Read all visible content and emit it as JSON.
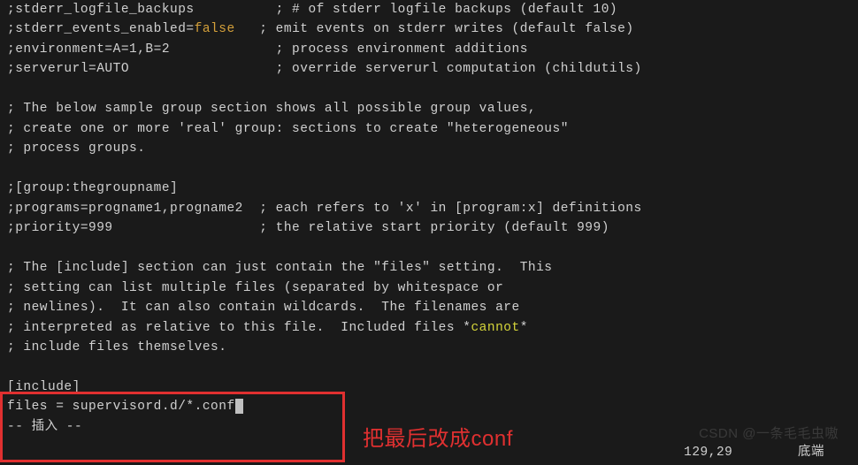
{
  "lines": [
    {
      "segments": [
        {
          "t": ";stderr_logfile_backups          ; # of stderr logfile backups (default 10)"
        }
      ]
    },
    {
      "segments": [
        {
          "t": ";stderr_events_enabled="
        },
        {
          "t": "false",
          "cls": "kw-false"
        },
        {
          "t": "   ; emit events on stderr writes (default false)"
        }
      ]
    },
    {
      "segments": [
        {
          "t": ";environment=A=1,B=2             ; process environment additions"
        }
      ]
    },
    {
      "segments": [
        {
          "t": ";serverurl=AUTO                  ; override serverurl computation (childutils)"
        }
      ]
    },
    {
      "segments": [
        {
          "t": " "
        }
      ]
    },
    {
      "segments": [
        {
          "t": "; The below sample group section shows all possible group values,"
        }
      ]
    },
    {
      "segments": [
        {
          "t": "; create one or more 'real' group: sections to create \"heterogeneous\""
        }
      ]
    },
    {
      "segments": [
        {
          "t": "; process groups."
        }
      ]
    },
    {
      "segments": [
        {
          "t": " "
        }
      ]
    },
    {
      "segments": [
        {
          "t": ";[group:thegroupname]"
        }
      ]
    },
    {
      "segments": [
        {
          "t": ";programs=progname1,progname2  ; each refers to 'x' in [program:x] definitions"
        }
      ]
    },
    {
      "segments": [
        {
          "t": ";priority=999                  ; the relative start priority (default 999)"
        }
      ]
    },
    {
      "segments": [
        {
          "t": " "
        }
      ]
    },
    {
      "segments": [
        {
          "t": "; The [include] section can just contain the \"files\" setting.  This"
        }
      ]
    },
    {
      "segments": [
        {
          "t": "; setting can list multiple files (separated by whitespace or"
        }
      ]
    },
    {
      "segments": [
        {
          "t": "; newlines).  It can also contain wildcards.  The filenames are"
        }
      ]
    },
    {
      "segments": [
        {
          "t": "; interpreted as relative to this file.  Included files *"
        },
        {
          "t": "cannot",
          "cls": "kw-cannot"
        },
        {
          "t": "*"
        }
      ]
    },
    {
      "segments": [
        {
          "t": "; include files themselves."
        }
      ]
    },
    {
      "segments": [
        {
          "t": " "
        }
      ]
    },
    {
      "segments": [
        {
          "t": "[include]"
        }
      ]
    },
    {
      "segments": [
        {
          "t": "files = supervisord.d/*.conf"
        },
        {
          "cursor": true
        }
      ]
    },
    {
      "segments": [
        {
          "t": "-- 插入 --"
        }
      ]
    }
  ],
  "annotation": "把最后改成conf",
  "watermark": "CSDN @一条毛毛虫嗷",
  "status": {
    "position": "129,29",
    "location": "底端"
  }
}
